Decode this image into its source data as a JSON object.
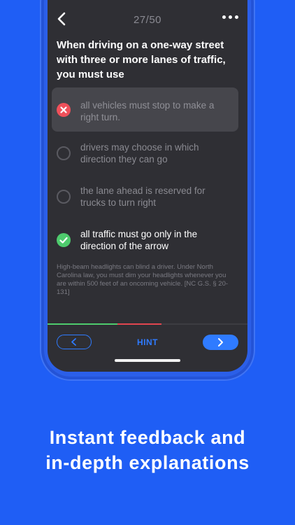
{
  "header": {
    "counter": "27/50"
  },
  "question": "When driving on a one-way street with three or more lanes of traffic, you must use",
  "answers": [
    {
      "text": "all vehicles must stop to make a right turn.",
      "state": "wrong"
    },
    {
      "text": "drivers may choose in which direction they can go",
      "state": "neutral"
    },
    {
      "text": "the lane ahead is reserved for trucks to turn right",
      "state": "neutral"
    },
    {
      "text": "all traffic must go only in the direction of the arrow",
      "state": "correct"
    }
  ],
  "explanation": "High-beam headlights can blind a driver. Under North Carolina law, you must dim your headlights whenever you are within 500 feet of an oncoming vehicle. [NC G.S. § 20-131]",
  "progress": {
    "correct_fraction": 0.35,
    "wrong_fraction": 0.22
  },
  "footer": {
    "hint_label": "HINT"
  },
  "caption": {
    "line1": "Instant feedback and",
    "line2": "in-depth explanations"
  },
  "colors": {
    "background": "#1f5ef5",
    "accent": "#2f7bff",
    "correct": "#4ecb6d",
    "wrong": "#f0505a"
  },
  "icons": {
    "back": "chevron-left-icon",
    "menu": "more-dots-icon",
    "wrong": "x-icon",
    "correct": "check-icon",
    "prev": "chevron-left-icon",
    "next": "chevron-right-icon"
  }
}
